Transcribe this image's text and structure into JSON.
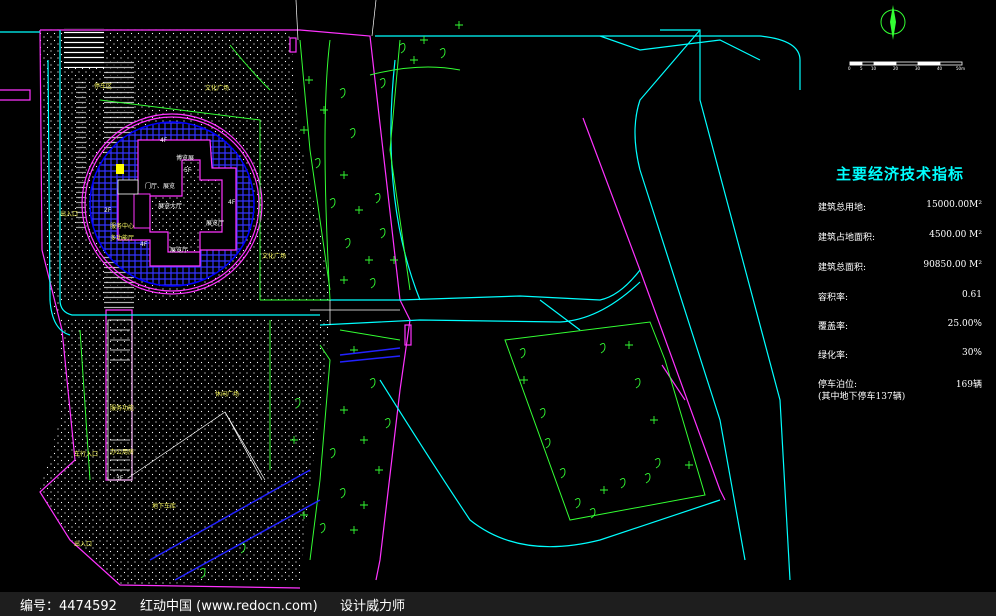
{
  "indicators": {
    "title": "主要经济技术指标",
    "rows": [
      {
        "label": "建筑总用地:",
        "value": "15000.00M²"
      },
      {
        "label": "建筑占地面积:",
        "value": "4500.00 M²"
      },
      {
        "label": "建筑总面积:",
        "value": "90850.00 M²"
      },
      {
        "label": "容积率:",
        "value": "0.61"
      },
      {
        "label": "覆盖率:",
        "value": "25.00%"
      },
      {
        "label": "绿化率:",
        "value": "30%"
      },
      {
        "label": "停车泊位:",
        "value": "169辆",
        "note": "(其中地下停车137辆)"
      }
    ]
  },
  "scale_bar": {
    "ticks": [
      "0",
      "5",
      "10",
      "20",
      "30",
      "40",
      "50m"
    ]
  },
  "plan_labels": {
    "exhibition_hall": "展览大厅",
    "expo_booth": "博览展",
    "gallery": "展览厅",
    "lobby": "门厅、展览",
    "floor_4f_top": "4F",
    "floor_5f": "5F",
    "floor_4f_right": "4F",
    "floor_2f": "2F",
    "floor_4f_bottom": "4F",
    "service_center": "服务中心",
    "multi_function": "多功能厅",
    "entrance_left": "出入口",
    "parking_zone": "停车区",
    "square_north": "文化广场",
    "square_mid": "文化广场",
    "leisure_square": "休闲广场",
    "admin_building": "服务功能",
    "office_building": "办公用房",
    "floor_3f": "3F",
    "entrance_south": "车行入口",
    "entrance_bottom": "出入口",
    "service_road": "地下车库"
  },
  "colors": {
    "boundary": "#ff33ff",
    "road": "#00ffff",
    "green": "#33ff33",
    "building": "#0000ff",
    "text": "#ffff66"
  },
  "footer": {
    "id_text": "编号：4474592",
    "site_text": "红动中国 (www.redocn.com)",
    "author_text": "设计威力师"
  }
}
